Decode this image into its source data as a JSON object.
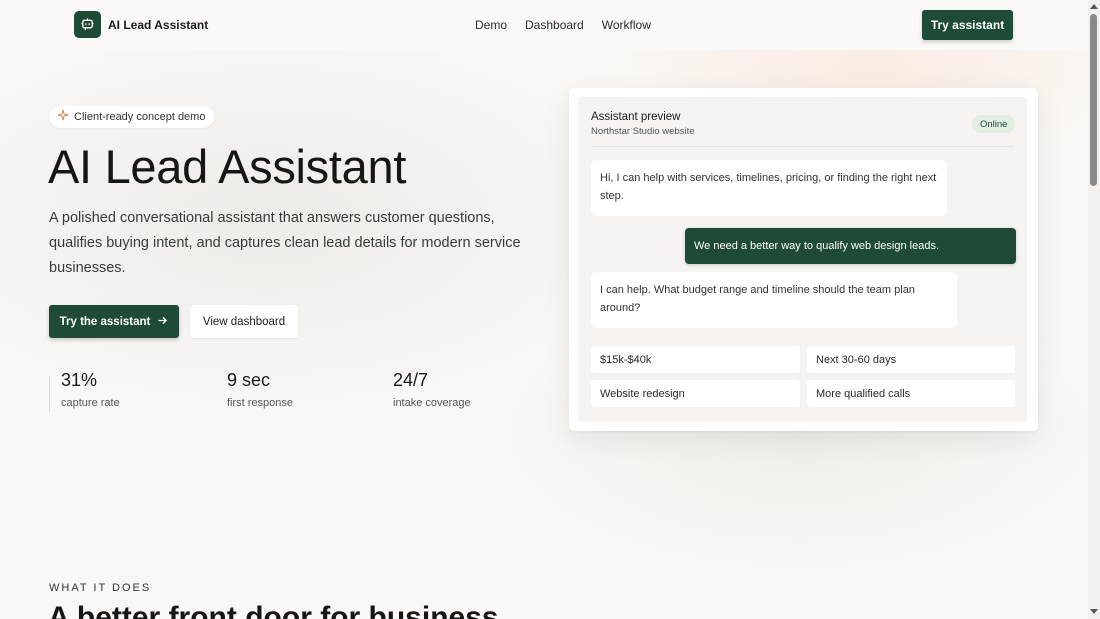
{
  "header": {
    "brand": "AI Lead Assistant",
    "nav": [
      "Demo",
      "Dashboard",
      "Workflow"
    ],
    "cta": "Try assistant"
  },
  "hero": {
    "pill": "Client-ready concept demo",
    "title": "AI Lead Assistant",
    "description": "A polished conversational assistant that answers customer questions, qualifies buying intent, and captures clean lead details for modern service businesses.",
    "primary_button": "Try the assistant",
    "secondary_button": "View dashboard",
    "stats": [
      {
        "value": "31%",
        "label": "capture rate"
      },
      {
        "value": "9 sec",
        "label": "first response"
      },
      {
        "value": "24/7",
        "label": "intake coverage"
      }
    ]
  },
  "preview": {
    "title": "Assistant preview",
    "subtitle": "Northstar Studio website",
    "status": "Online",
    "messages": [
      {
        "role": "assistant",
        "text": "Hi, I can help with services, timelines, pricing, or finding the right next step."
      },
      {
        "role": "user",
        "text": "We need a better way to qualify web design leads."
      },
      {
        "role": "assistant",
        "text": "I can help. What budget range and timeline should the team plan around?"
      }
    ],
    "chips": [
      "$15k-$40k",
      "Next 30-60 days",
      "Website redesign",
      "More qualified calls"
    ]
  },
  "section": {
    "eyebrow": "WHAT IT DOES",
    "title": "A better front door for business"
  },
  "colors": {
    "brand": "#1e4a36",
    "background": "#faf8f5",
    "online_badge": "#e2efe1",
    "sparkle": "#d08a4a"
  },
  "icons": {
    "logo": "chat-bot-icon",
    "pill": "sparkle-icon",
    "primary_button": "arrow-right-icon"
  }
}
